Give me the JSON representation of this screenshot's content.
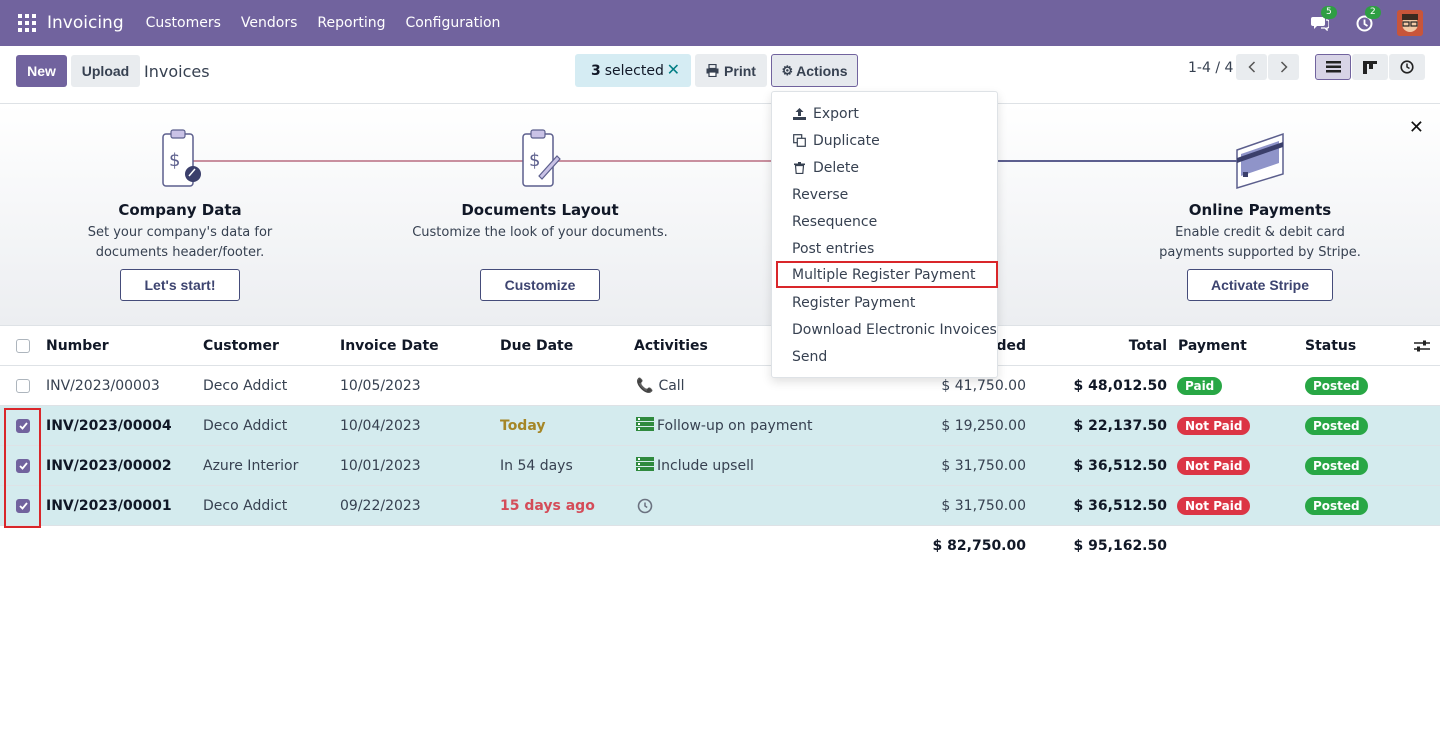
{
  "navbar": {
    "brand": "Invoicing",
    "menu": [
      "Customers",
      "Vendors",
      "Reporting",
      "Configuration"
    ],
    "chat_count": "5",
    "activity_count": "2"
  },
  "control": {
    "new_label": "New",
    "upload_label": "Upload",
    "title": "Invoices",
    "selected_count": "3",
    "selected_label": "selected",
    "print_label": "Print",
    "actions_label": "Actions",
    "pager": "1-4 / 4"
  },
  "onboarding": {
    "steps": [
      {
        "title": "Company Data",
        "desc": "Set your company's data for documents header/footer.",
        "button": "Let's start!"
      },
      {
        "title": "Documents Layout",
        "desc": "Customize the look of your documents.",
        "button": "Customize"
      },
      {
        "title": "Online Payments",
        "desc": "Enable credit & debit card payments supported by Stripe.",
        "button": "Activate Stripe"
      }
    ]
  },
  "table": {
    "headers": {
      "number": "Number",
      "customer": "Customer",
      "invoice_date": "Invoice Date",
      "due_date": "Due Date",
      "activities": "Activities",
      "untaxed": "uded",
      "total": "Total",
      "payment": "Payment",
      "status": "Status"
    },
    "rows": [
      {
        "number": "INV/2023/00003",
        "customer": "Deco Addict",
        "invoice_date": "10/05/2023",
        "due_date": "",
        "activity": "Call",
        "untaxed": "$ 41,750.00",
        "total": "$ 48,012.50",
        "payment": "Paid",
        "status": "Posted"
      },
      {
        "number": "INV/2023/00004",
        "customer": "Deco Addict",
        "invoice_date": "10/04/2023",
        "due_date": "Today",
        "activity": "Follow-up on payment",
        "untaxed": "$ 19,250.00",
        "total": "$ 22,137.50",
        "payment": "Not Paid",
        "status": "Posted"
      },
      {
        "number": "INV/2023/00002",
        "customer": "Azure Interior",
        "invoice_date": "10/01/2023",
        "due_date": "In 54 days",
        "activity": "Include upsell",
        "untaxed": "$ 31,750.00",
        "total": "$ 36,512.50",
        "payment": "Not Paid",
        "status": "Posted"
      },
      {
        "number": "INV/2023/00001",
        "customer": "Deco Addict",
        "invoice_date": "09/22/2023",
        "due_date": "15 days ago",
        "activity": "",
        "untaxed": "$ 31,750.00",
        "total": "$ 36,512.50",
        "payment": "Not Paid",
        "status": "Posted"
      }
    ],
    "totals": {
      "untaxed": "$ 82,750.00",
      "total": "$ 95,162.50"
    }
  },
  "actions_menu": {
    "items": [
      "Export",
      "Duplicate",
      "Delete",
      "Reverse",
      "Resequence",
      "Post entries",
      "Multiple Register Payment",
      "Register Payment",
      "Download Electronic Invoices",
      "Send"
    ]
  },
  "colors": {
    "brand": "#71639e",
    "paid": "#28a745",
    "not_paid": "#dc3545",
    "selected_row": "#d4ebee",
    "highlight": "#d9262a"
  }
}
